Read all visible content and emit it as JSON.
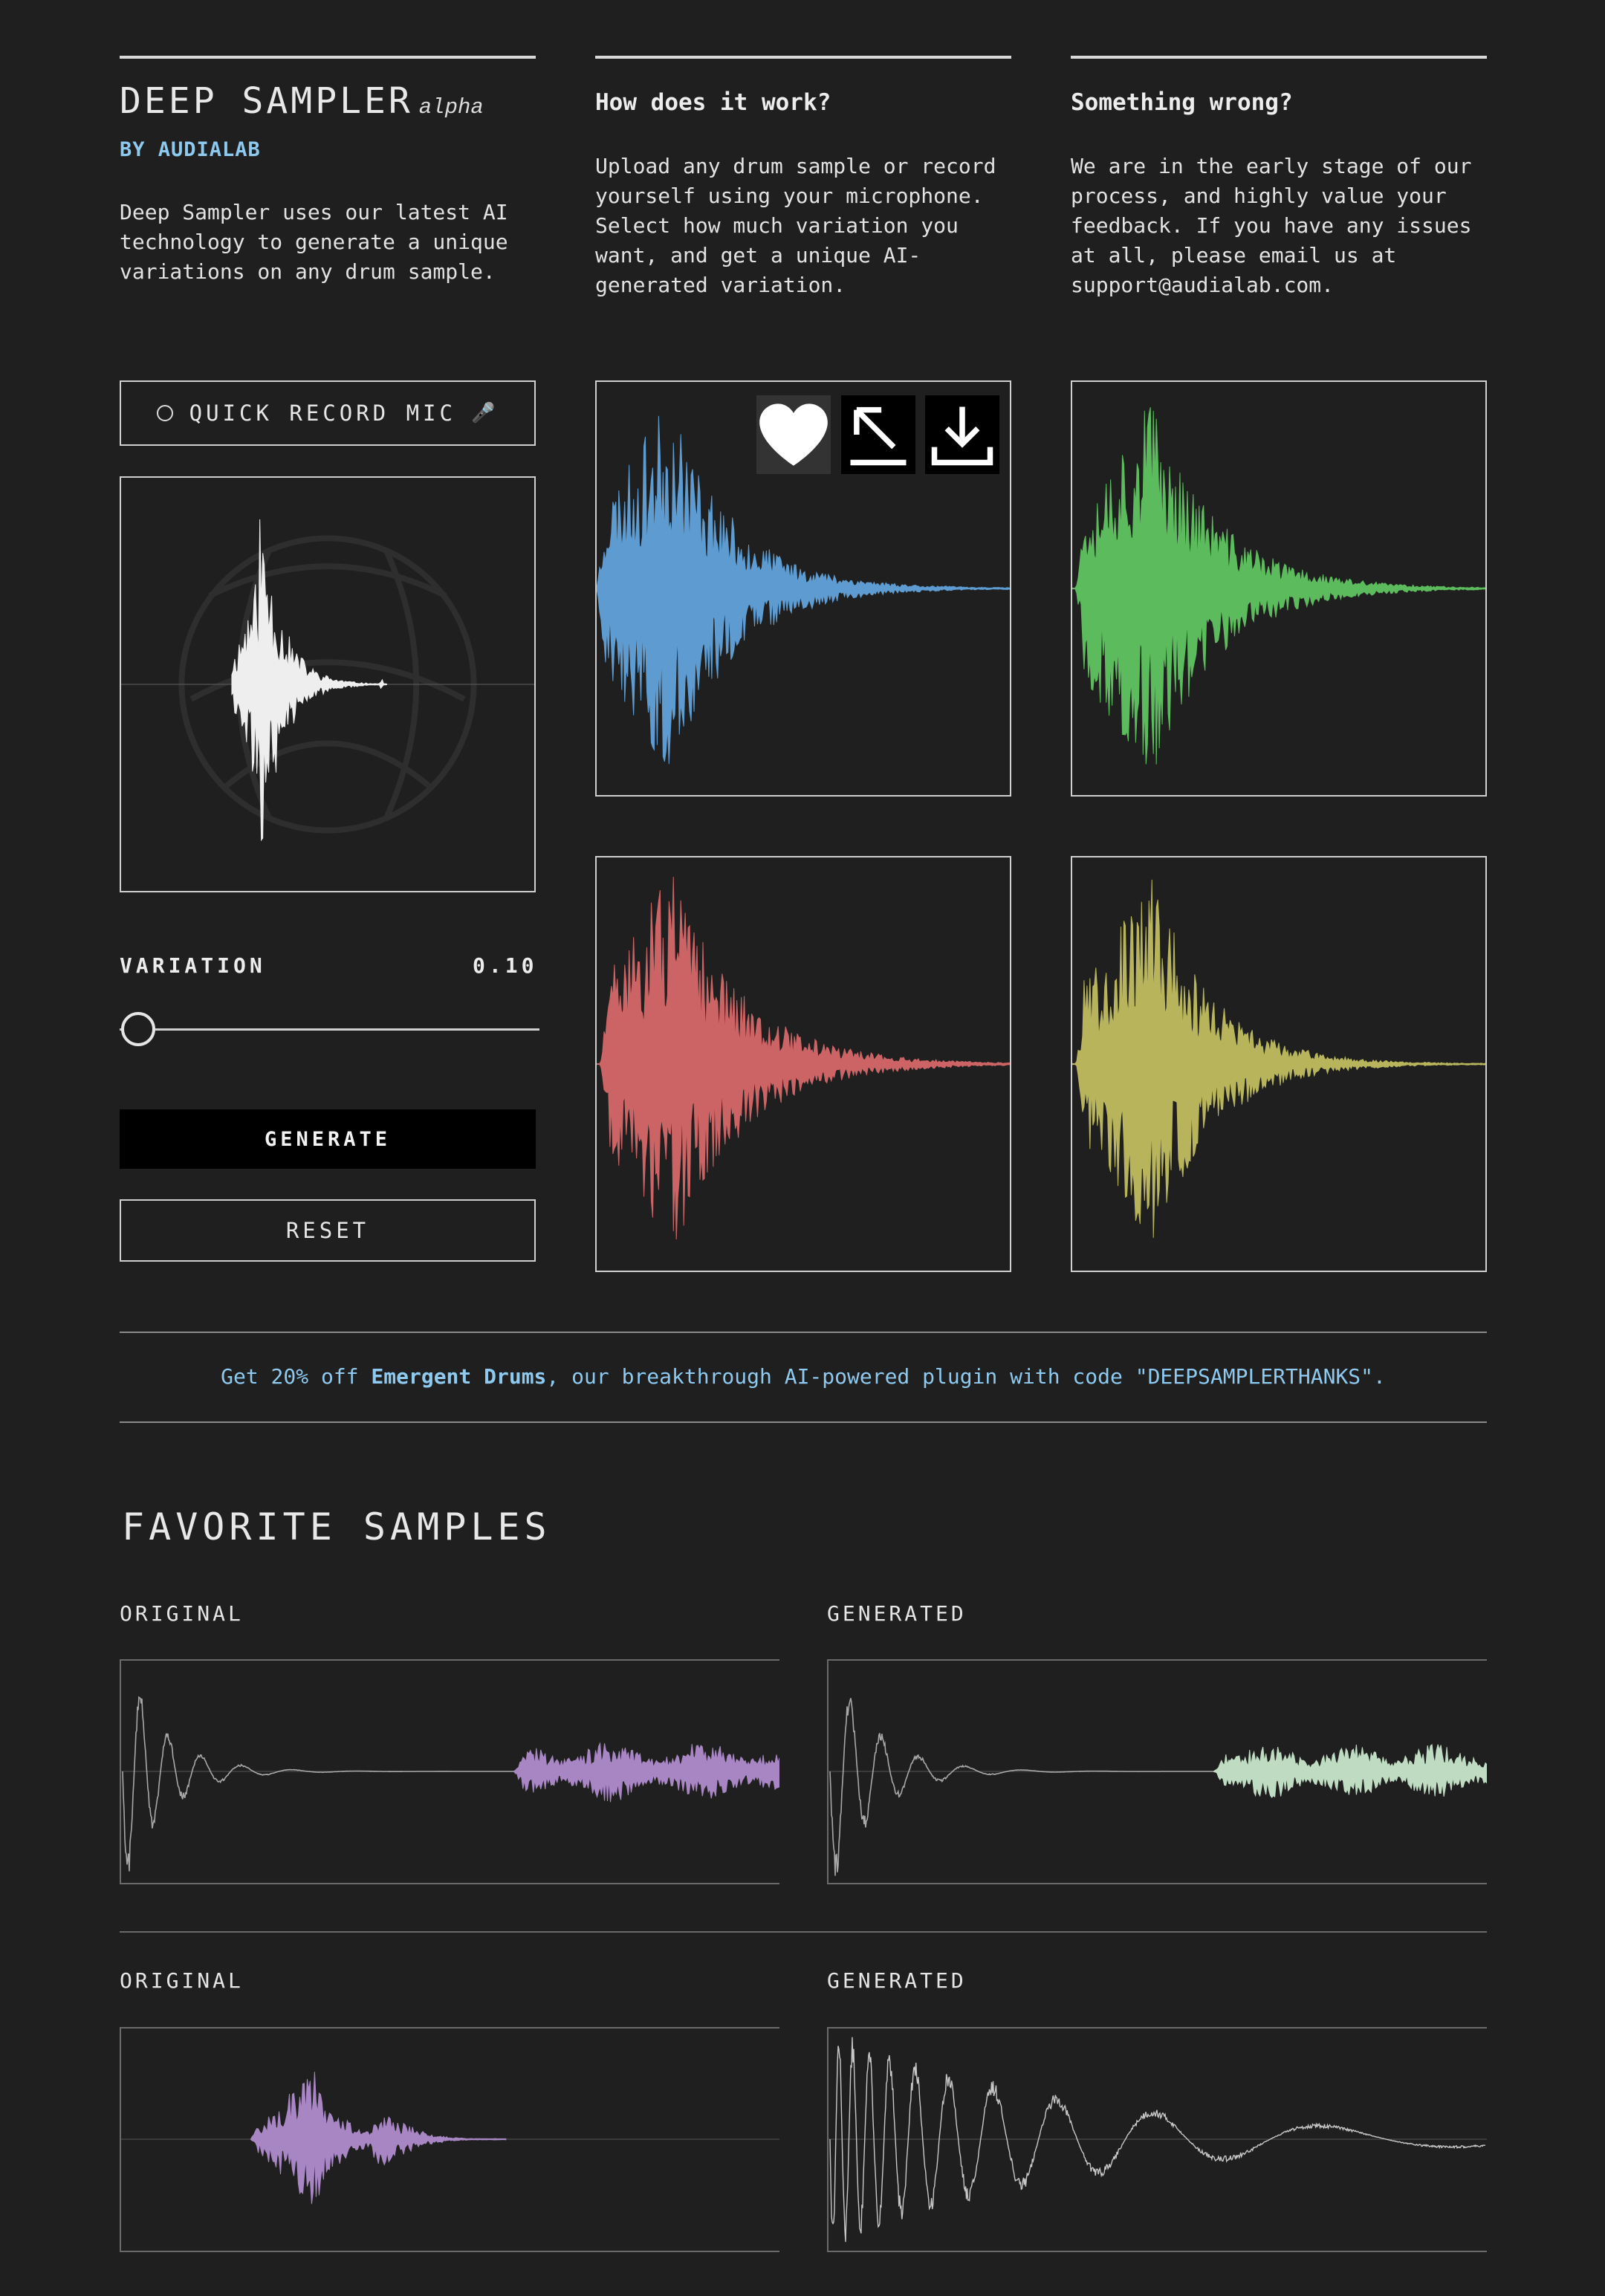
{
  "brand": {
    "title": "DEEP SAMPLER",
    "tag": "alpha",
    "byline": "BY AUDIALAB",
    "description": "Deep Sampler uses our latest AI technology to generate a unique variations on any drum sample."
  },
  "how_it_works": {
    "heading": "How does it work?",
    "body": "Upload any drum sample or record yourself using your microphone. Select how much variation you want, and get a unique AI-generated variation."
  },
  "something_wrong": {
    "heading": "Something wrong?",
    "body": "We are in the early stage of our process, and highly value your feedback. If you have any issues at all, please email us at support@audialab.com."
  },
  "controls": {
    "record_label": "QUICK RECORD MIC",
    "variation_label": "VARIATION",
    "variation_value": "0.10",
    "variation_level": 0.1,
    "generate_label": "GENERATE",
    "reset_label": "RESET"
  },
  "sample_actions": {
    "icons": [
      "heart-icon",
      "expand-icon",
      "download-icon"
    ]
  },
  "variations": {
    "colors": {
      "input": "#eeeeee",
      "blue": "#5d9bd0",
      "green": "#5cbb5c",
      "red": "#cc6466",
      "yellow": "#b7b45c"
    }
  },
  "promo": {
    "before": "Get 20% off ",
    "product": "Emergent Drums",
    "after": ", our breakthrough AI-powered plugin with code \"DEEPSAMPLERTHANKS\"."
  },
  "favorites": {
    "title": "FAVORITE SAMPLES",
    "rows": [
      {
        "original_label": "ORIGINAL",
        "generated_label": "GENERATED"
      },
      {
        "original_label": "ORIGINAL",
        "generated_label": "GENERATED"
      }
    ],
    "colors": {
      "purple": "#a886c4",
      "mint": "#bfdcc2",
      "line": "#a8a8a8"
    }
  }
}
